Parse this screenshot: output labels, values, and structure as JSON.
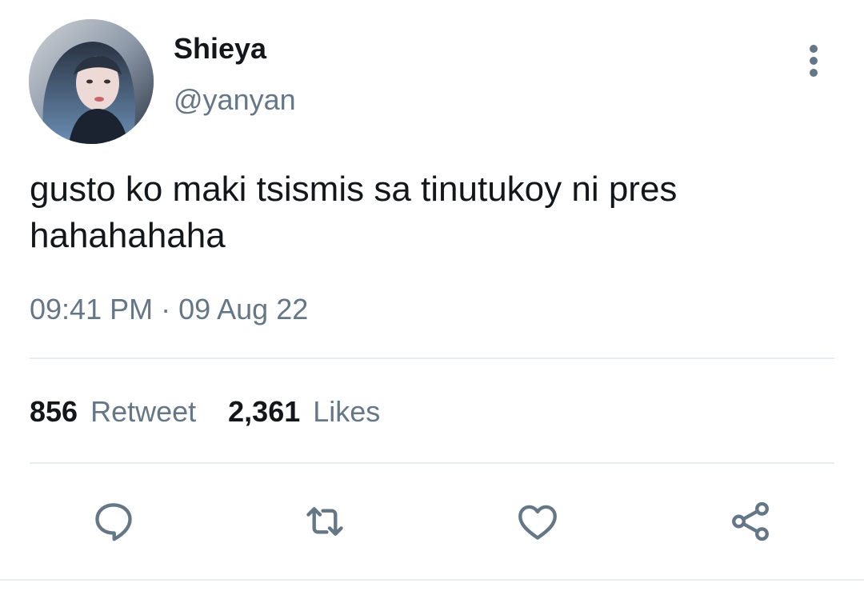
{
  "user": {
    "display_name": "Shieya",
    "handle": "@yanyan"
  },
  "tweet": {
    "text": "gusto ko maki tsismis sa tinutukoy ni pres\nhahahahaha",
    "timestamp": "09:41 PM · 09 Aug 22"
  },
  "stats": {
    "retweet_count": "856",
    "retweet_label": "Retweet",
    "likes_count": "2,361",
    "likes_label": "Likes"
  },
  "icons": {
    "more": "more-vertical-icon",
    "reply": "reply-icon",
    "retweet": "retweet-icon",
    "like": "heart-icon",
    "share": "share-icon"
  },
  "colors": {
    "text_primary": "#14171a",
    "text_secondary": "#657786",
    "divider": "#e6ecf0"
  }
}
